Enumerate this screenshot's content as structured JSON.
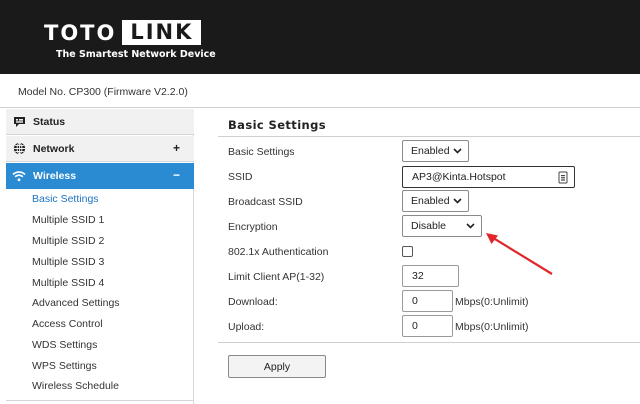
{
  "brand": {
    "logo_left": "TOTO",
    "logo_right": "LINK",
    "tagline": "The Smartest Network Device"
  },
  "model_text": "Model No. CP300 (Firmware V2.2.0)",
  "sidebar": {
    "items": [
      {
        "label": "Status",
        "icon": "status-icon",
        "expandable": false
      },
      {
        "label": "Network",
        "icon": "globe-icon",
        "expandable": true,
        "toggle": "+"
      },
      {
        "label": "Wireless",
        "icon": "wifi-icon",
        "expandable": true,
        "toggle": "−",
        "active": true
      }
    ],
    "subitems": [
      "Basic Settings",
      "Multiple SSID 1",
      "Multiple SSID 2",
      "Multiple SSID 3",
      "Multiple SSID 4",
      "Advanced Settings",
      "Access Control",
      "WDS Settings",
      "WPS Settings",
      "Wireless Schedule"
    ],
    "selected_subitem": "Basic Settings"
  },
  "content": {
    "title": "Basic Settings",
    "fields": {
      "basic_settings": {
        "label": "Basic Settings",
        "value": "Enabled"
      },
      "ssid": {
        "label": "SSID",
        "value": "AP3@Kinta.Hotspot"
      },
      "broadcast_ssid": {
        "label": "Broadcast SSID",
        "value": "Enabled"
      },
      "encryption": {
        "label": "Encryption",
        "value": "Disable"
      },
      "auth_8021x": {
        "label": "802.1x Authentication",
        "checked": false
      },
      "limit_client": {
        "label": "Limit Client AP(1-32)",
        "value": "32"
      },
      "download": {
        "label": "Download:",
        "value": "0",
        "unit": "Mbps(0:Unlimit)"
      },
      "upload": {
        "label": "Upload:",
        "value": "0",
        "unit": "Mbps(0:Unlimit)"
      }
    },
    "apply_label": "Apply"
  },
  "colors": {
    "header_bg": "#1a1a1a",
    "accent": "#2a8ad2",
    "selected_link": "#1d73c2",
    "annotation_arrow": "#e0262a"
  }
}
